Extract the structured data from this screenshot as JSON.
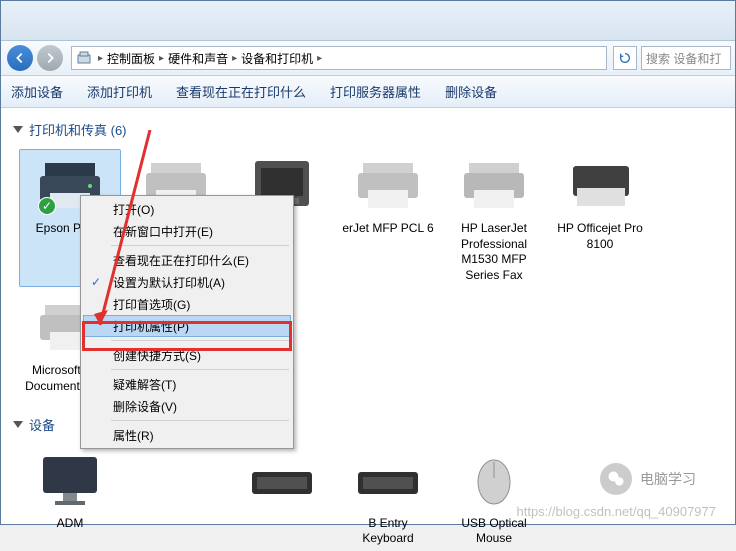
{
  "breadcrumb": {
    "items": [
      "控制面板",
      "硬件和声音",
      "设备和打印机"
    ]
  },
  "search": {
    "placeholder": "搜索 设备和打"
  },
  "toolbar": {
    "add_device": "添加设备",
    "add_printer": "添加打印机",
    "view_printing": "查看现在正在打印什么",
    "server_props": "打印服务器属性",
    "remove_device": "删除设备"
  },
  "sections": {
    "printers": {
      "title": "打印机和传真 (6)"
    },
    "devices": {
      "title": "设备"
    }
  },
  "printers": [
    {
      "name": "Epson\nPhoto"
    },
    {
      "name": ""
    },
    {
      "name": ""
    },
    {
      "name": "erJet\nMFP\nPCL 6"
    },
    {
      "name": "HP LaserJet Professional M1530 MFP Series Fax"
    },
    {
      "name": "HP Officejet Pro 8100"
    },
    {
      "name": "Microsoft XPS Document Writer"
    }
  ],
  "devices": [
    {
      "name": "ADM"
    },
    {
      "name": ""
    },
    {
      "name": ""
    },
    {
      "name": "B Entry Keyboard"
    },
    {
      "name": "USB Optical Mouse"
    }
  ],
  "ctxmenu": {
    "open": "打开(O)",
    "open_new_window": "在新窗口中打开(E)",
    "view_printing_e": "查看现在正在打印什么(E)",
    "set_default": "设置为默认打印机(A)",
    "print_prefs": "打印首选项(G)",
    "printer_props": "打印机属性(P)",
    "create_shortcut": "创建快捷方式(S)",
    "troubleshoot": "疑难解答(T)",
    "remove": "删除设备(V)",
    "properties": "属性(R)"
  },
  "watermarks": {
    "wechat": "电脑学习",
    "csdn": "https://blog.csdn.net/qq_40907977"
  }
}
